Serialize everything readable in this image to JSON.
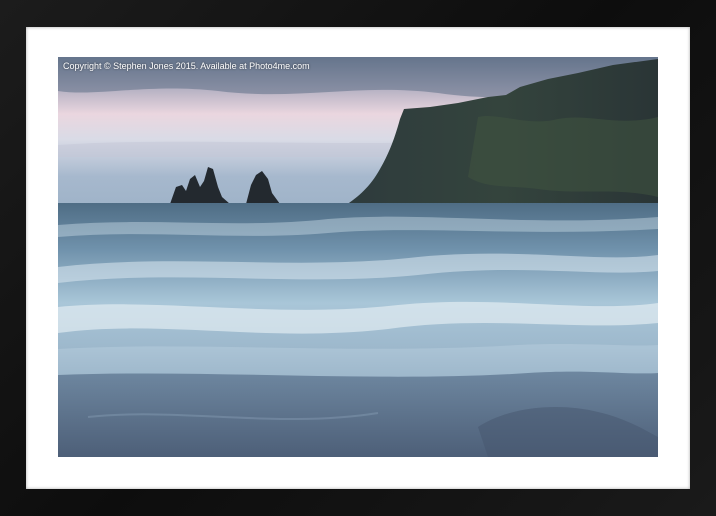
{
  "watermark": {
    "copyright_text": "Copyright © Stephen Jones 2015. Available at Photo4me.com"
  },
  "frame": {
    "frame_color": "#111111",
    "mat_color": "#ffffff"
  },
  "photo": {
    "sky_colors": [
      "#6f7f96",
      "#e9d4de",
      "#a9bdd1"
    ],
    "sea_color": "#6f8fa8",
    "sand_color": "#5b6f88"
  }
}
